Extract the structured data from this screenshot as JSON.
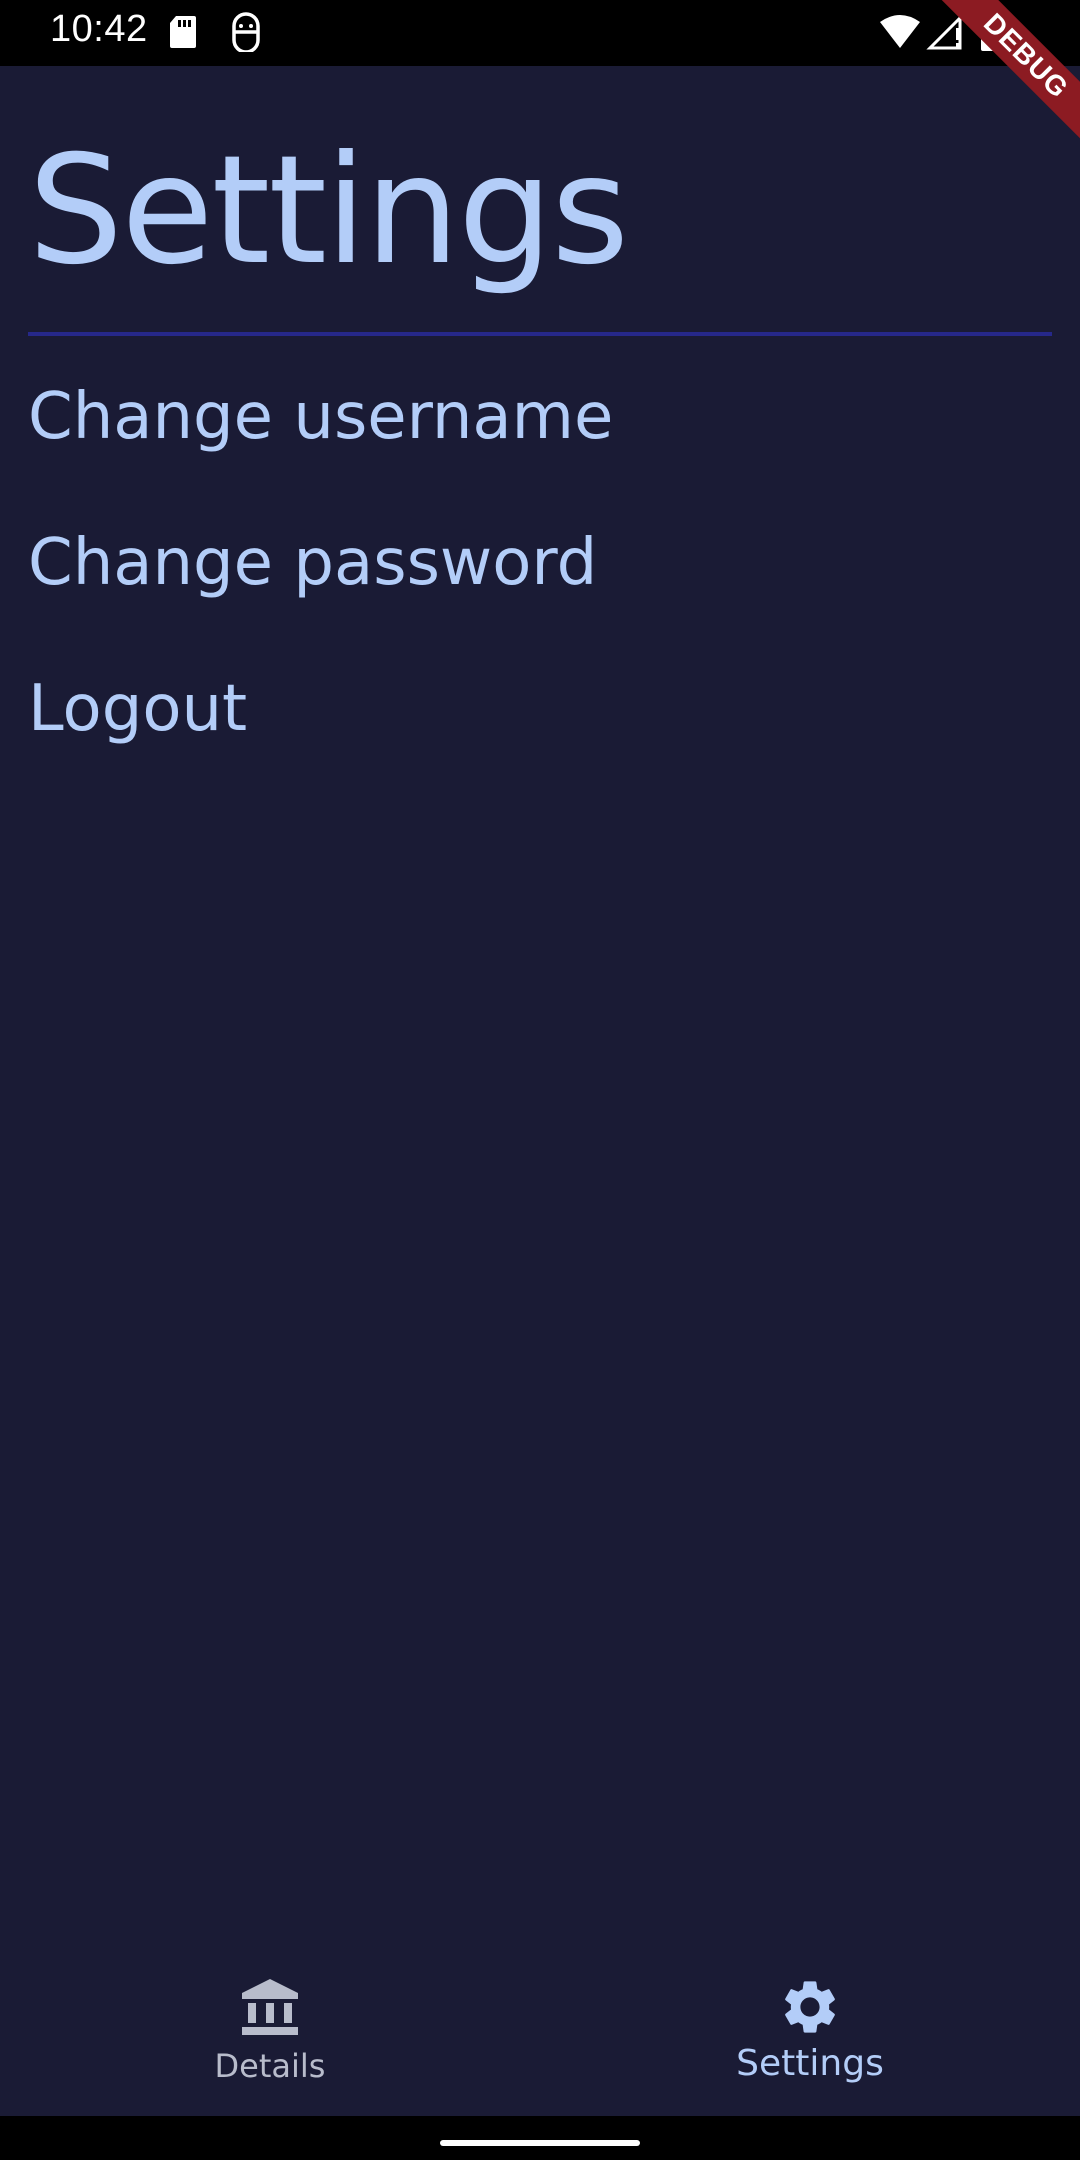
{
  "status_bar": {
    "time": "10:42",
    "icons": [
      "sdcard-icon",
      "face-icon",
      "wifi-icon",
      "signal-icon",
      "battery-icon"
    ]
  },
  "debug_banner": "DEBUG",
  "page": {
    "title": "Settings"
  },
  "menu": {
    "items": [
      {
        "label": "Change username"
      },
      {
        "label": "Change password"
      },
      {
        "label": "Logout"
      }
    ]
  },
  "bottom_nav": {
    "items": [
      {
        "label": "Details",
        "icon": "bank-icon",
        "selected": false
      },
      {
        "label": "Settings",
        "icon": "gear-icon",
        "selected": true
      }
    ]
  },
  "colors": {
    "background": "#1a1b35",
    "accent_text": "#b3cdf8",
    "divider": "#26288a",
    "inactive_nav": "#b8bccb",
    "debug_ribbon": "#8c1b22"
  }
}
